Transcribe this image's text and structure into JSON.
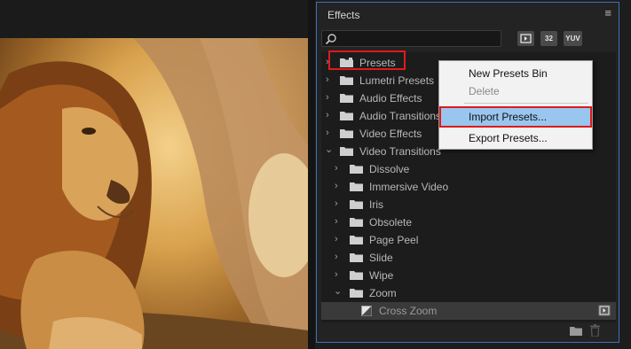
{
  "panel": {
    "title": "Effects",
    "menu_icon": "hamburger-icon",
    "search": {
      "value": "",
      "placeholder": ""
    },
    "filters": [
      {
        "label": "",
        "icon": "accelerated-effects-icon"
      },
      {
        "label": "32",
        "icon": "32-bit-effects-icon"
      },
      {
        "label": "YUV",
        "icon": "yuv-effects-icon"
      }
    ]
  },
  "tree": [
    {
      "label": "Presets",
      "expanded": false
    },
    {
      "label": "Lumetri Presets",
      "expanded": false
    },
    {
      "label": "Audio Effects",
      "expanded": false
    },
    {
      "label": "Audio Transitions",
      "expanded": false
    },
    {
      "label": "Video Effects",
      "expanded": false
    },
    {
      "label": "Video Transitions",
      "expanded": true
    },
    {
      "label": "Dissolve",
      "expanded": false
    },
    {
      "label": "Immersive Video",
      "expanded": false
    },
    {
      "label": "Iris",
      "expanded": false
    },
    {
      "label": "Obsolete",
      "expanded": false
    },
    {
      "label": "Page Peel",
      "expanded": false
    },
    {
      "label": "Slide",
      "expanded": false
    },
    {
      "label": "Wipe",
      "expanded": false
    },
    {
      "label": "Zoom",
      "expanded": true
    },
    {
      "label": "Cross Zoom",
      "selected": true
    }
  ],
  "context_menu": {
    "items": [
      {
        "label": "New Presets Bin",
        "enabled": true
      },
      {
        "label": "Delete",
        "enabled": false
      },
      {
        "label": "Import Presets...",
        "enabled": true,
        "highlighted": true
      },
      {
        "label": "Export Presets...",
        "enabled": true
      }
    ]
  },
  "colors": {
    "panel_border": "#3d72b8",
    "menu_highlight": "#99c6ee",
    "annotation_red": "#e01a1a"
  }
}
